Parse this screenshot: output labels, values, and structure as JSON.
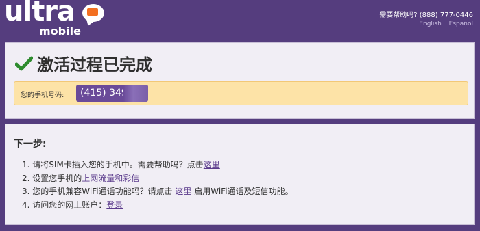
{
  "header": {
    "logo_word": "ultra",
    "logo_sub": "mobile",
    "help_text": "需要帮助吗?",
    "help_phone": "(888) 777-0446",
    "languages": [
      "English",
      "Español"
    ]
  },
  "activation": {
    "title": "激活过程已完成",
    "phone_label": "您的手机号码:",
    "phone_number": "(415) 349"
  },
  "next_steps": {
    "title": "下一步:",
    "steps": [
      {
        "num": "1.",
        "text": "请将SIM卡插入您的手机中。需要帮助吗？点击",
        "link": "这里",
        "after": ""
      },
      {
        "num": "2.",
        "text": "设置您手机的",
        "link": "上网流量和彩信",
        "after": ""
      },
      {
        "num": "3.",
        "text": "您的手机兼容WiFi通话功能吗？请点击 ",
        "link": "这里",
        "after": " 启用WiFi通话及短信功能。"
      },
      {
        "num": "4.",
        "text": "访问您的网上账户：",
        "link": "登录",
        "after": ""
      }
    ]
  },
  "colors": {
    "background": "#553d7e",
    "check": "#2e8b2e",
    "link": "#5b3b8c",
    "phone_box": "#fde3a7"
  }
}
